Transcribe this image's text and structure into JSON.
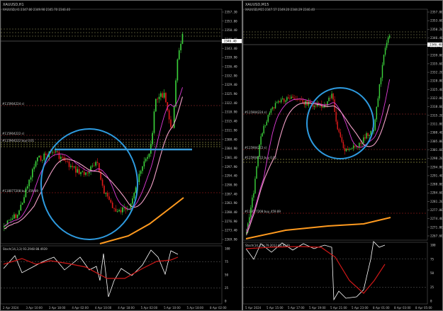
{
  "left": {
    "title": "XAUUSD,H1",
    "ohlc": "XAUUSD,H1  2347.80 2349.98 2345.70 2346.40",
    "price_labels": [
      "2357.30",
      "2353.80",
      "2350.40",
      "2346.40",
      "2343.40",
      "2339.90",
      "2336.40",
      "2332.90",
      "2329.40",
      "2325.90",
      "2322.40",
      "2318.90",
      "2315.40",
      "2311.90",
      "2308.40",
      "2304.90",
      "2301.40",
      "2297.90",
      "2294.40",
      "2290.90",
      "2287.40",
      "2283.90",
      "2280.40",
      "2276.90",
      "2273.40",
      "2269.90"
    ],
    "current_price": "2346.40",
    "level_labels": [
      "#115904224 sl",
      "#115904224 tp",
      "#115904222 sl",
      "#115904220 tp",
      "#115904222 buy 0.01",
      "#115904222 buy 0.01",
      "#115904224 buy 0.01",
      "#115904220 buy 0.01",
      "#118077208 buy_459.89"
    ],
    "indicator_label": "Stoch(14,3,3) 93.2948 88.4939",
    "indicator_levels": [
      "100",
      "75",
      "50",
      "25",
      "0"
    ],
    "time_labels": [
      "2 Apr 2024",
      "3 Apr 10:00",
      "3 Apr 18:00",
      "4 Apr 02:00",
      "4 Apr 10:00",
      "4 Apr 18:00",
      "5 Apr 02:00",
      "5 Apr 10:00",
      "5 Apr 18:00",
      "8 Apr 02:00"
    ]
  },
  "right": {
    "title": "XAUUSD,M15",
    "ohlc": "XAUUSD,M15  2347.57 2349.20 2344.29 2346.40",
    "price_labels": [
      "2357.00",
      "2353.60",
      "2350.20",
      "2346.40",
      "2343.40",
      "2339.00",
      "2335.60",
      "2332.20",
      "2328.80",
      "2325.40",
      "2322.00",
      "2318.60",
      "2315.20",
      "2311.80",
      "2308.40",
      "2305.00",
      "2301.60",
      "2298.20",
      "2294.80",
      "2291.40",
      "2288.00",
      "2284.60",
      "2281.20",
      "2277.80",
      "2274.40",
      "2271.00",
      "2267.60"
    ],
    "current_price": "2346.40",
    "level_labels": [
      "#115904224 sl",
      "#115904222 sl",
      "#115904222 buy 0.01",
      "#118077208 buy_459.89"
    ],
    "indicator_label": "Stoch(14,3,3) 79.2012 63.9539",
    "indicator_levels": [
      "100",
      "75",
      "50",
      "25",
      "0"
    ],
    "time_labels": [
      "5 Apr 2024",
      "5 Apr 15:00",
      "5 Apr 17:00",
      "5 Apr 19:00",
      "5 Apr 21:00",
      "5 Apr 23:00",
      "8 Apr 01:00",
      "8 Apr 03:00",
      "8 Apr 05:00"
    ]
  },
  "colors": {
    "bull": "#3bd13b",
    "bear": "#e01a1a",
    "ma_fast": "#e03ad8",
    "ma_mid": "#f2a0c8",
    "ma_slow": "#ff9a1f",
    "annotation": "#2e9be0",
    "level_line": "#b03030",
    "hline": "#3a9ad6"
  }
}
